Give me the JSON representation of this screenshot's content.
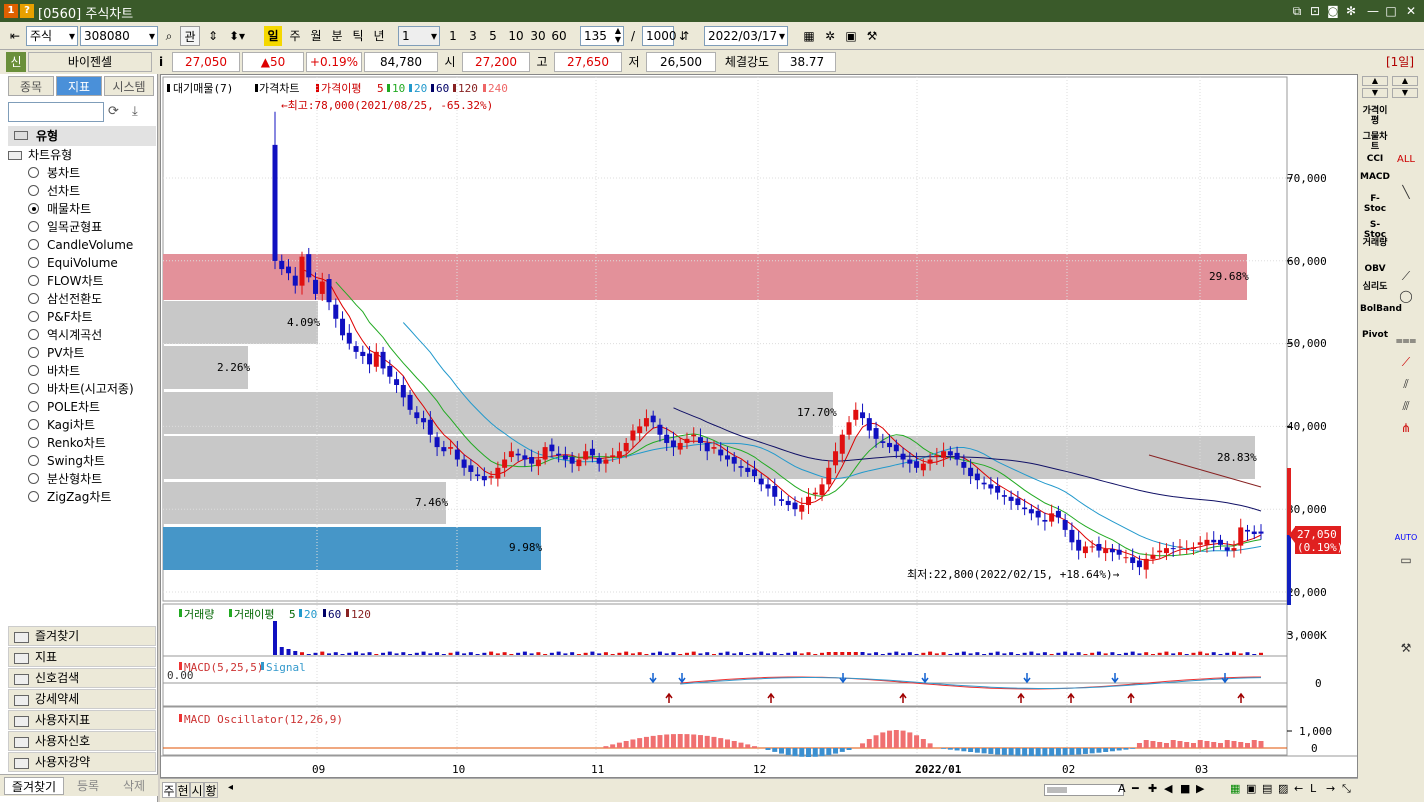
{
  "window": {
    "num1": "1",
    "num2": "?",
    "title": "[0560] 주식차트"
  },
  "toolbar": {
    "market": "주식",
    "code": "308080",
    "btn_gwan": "관",
    "periods": [
      "일",
      "주",
      "월",
      "분",
      "틱",
      "년"
    ],
    "unit_value": "1",
    "minutes": [
      "1",
      "3",
      "5",
      "10",
      "30",
      "60"
    ],
    "count": "135",
    "slash": "/",
    "max_count": "1000",
    "date": "2022/03/17"
  },
  "info": {
    "badge": "신",
    "name": "바이젠셀",
    "i": "i",
    "price": "27,050",
    "change": "▲50",
    "change_pct": "+0.19%",
    "volume": "84,780",
    "open_label": "시",
    "open": "27,200",
    "high_label": "고",
    "high": "27,650",
    "low_label": "저",
    "low": "26,500",
    "strength_label": "체결강도",
    "strength": "38.77",
    "period_badge": "[1일]"
  },
  "sidebar": {
    "tabs": [
      "종목",
      "지표",
      "시스템"
    ],
    "section": "유형",
    "tree_root": "차트유형",
    "types": [
      "봉차트",
      "선차트",
      "매물차트",
      "일목균형표",
      "CandleVolume",
      "EquiVolume",
      "FLOW차트",
      "삼선전환도",
      "P&F차트",
      "역시계곡선",
      "PV차트",
      "바차트",
      "바차트(시고저종)",
      "POLE차트",
      "Kagi차트",
      "Renko차트",
      "Swing차트",
      "분산형차트",
      "ZigZag차트"
    ],
    "selected_index": 2,
    "menus": [
      "즐겨찾기",
      "지표",
      "신호검색",
      "강세약세",
      "사용자지표",
      "사용자신호",
      "사용자강약"
    ],
    "bottom_tabs": [
      "즐겨찾기",
      "등록",
      "삭제"
    ]
  },
  "chart": {
    "legend": {
      "vp": "대기매물(7)",
      "price": "가격차트",
      "ma_label": "가격이평",
      "ma": [
        "5",
        "10",
        "20",
        "60",
        "120",
        "240"
      ]
    },
    "high_note": "←최고:78,000(2021/08/25, -65.32%)",
    "low_note": "최저:22,800(2022/02/15, +18.64%)→",
    "price_ticks": [
      "70,000",
      "60,000",
      "50,000",
      "40,000",
      "30,000",
      "20,000"
    ],
    "current_price": "27,050",
    "current_pct": "(0.19%)",
    "vp_pcts": [
      "29.68%",
      "4.09%",
      "2.26%",
      "17.70%",
      "28.83%",
      "7.46%",
      "9.98%"
    ],
    "vol_legend": {
      "vol": "거래량",
      "ma_label": "거래이평",
      "ma": [
        "5",
        "20",
        "60",
        "120"
      ]
    },
    "vol_tick": "3,000K",
    "macd_legend": {
      "macd": "MACD(5,25,5)",
      "signal": "Signal",
      "zero_note": "0.00"
    },
    "macd_tick": "0",
    "osc_legend": "MACD Oscillator(12,26,9)",
    "osc_ticks": [
      "1,000",
      "0"
    ],
    "x_labels": [
      "09",
      "10",
      "11",
      "12",
      "2022/01",
      "02",
      "03"
    ]
  },
  "rightbar": {
    "labels": [
      "가격이평",
      "그물차트",
      "CCI",
      "MACD",
      "F-Stoc",
      "S-Stoc",
      "거래량",
      "OBV",
      "심리도",
      "BolBand",
      "Pivot"
    ]
  },
  "statusbar": {
    "tabs": [
      "주",
      "현",
      "시",
      "황"
    ]
  },
  "colors": {
    "up": "#e01010",
    "down": "#1010c0",
    "vp_red": "#e3919a",
    "vp_gray": "#c8c8c8",
    "vp_blue": "#4696c8",
    "title_bg": "#3a5a2a"
  }
}
